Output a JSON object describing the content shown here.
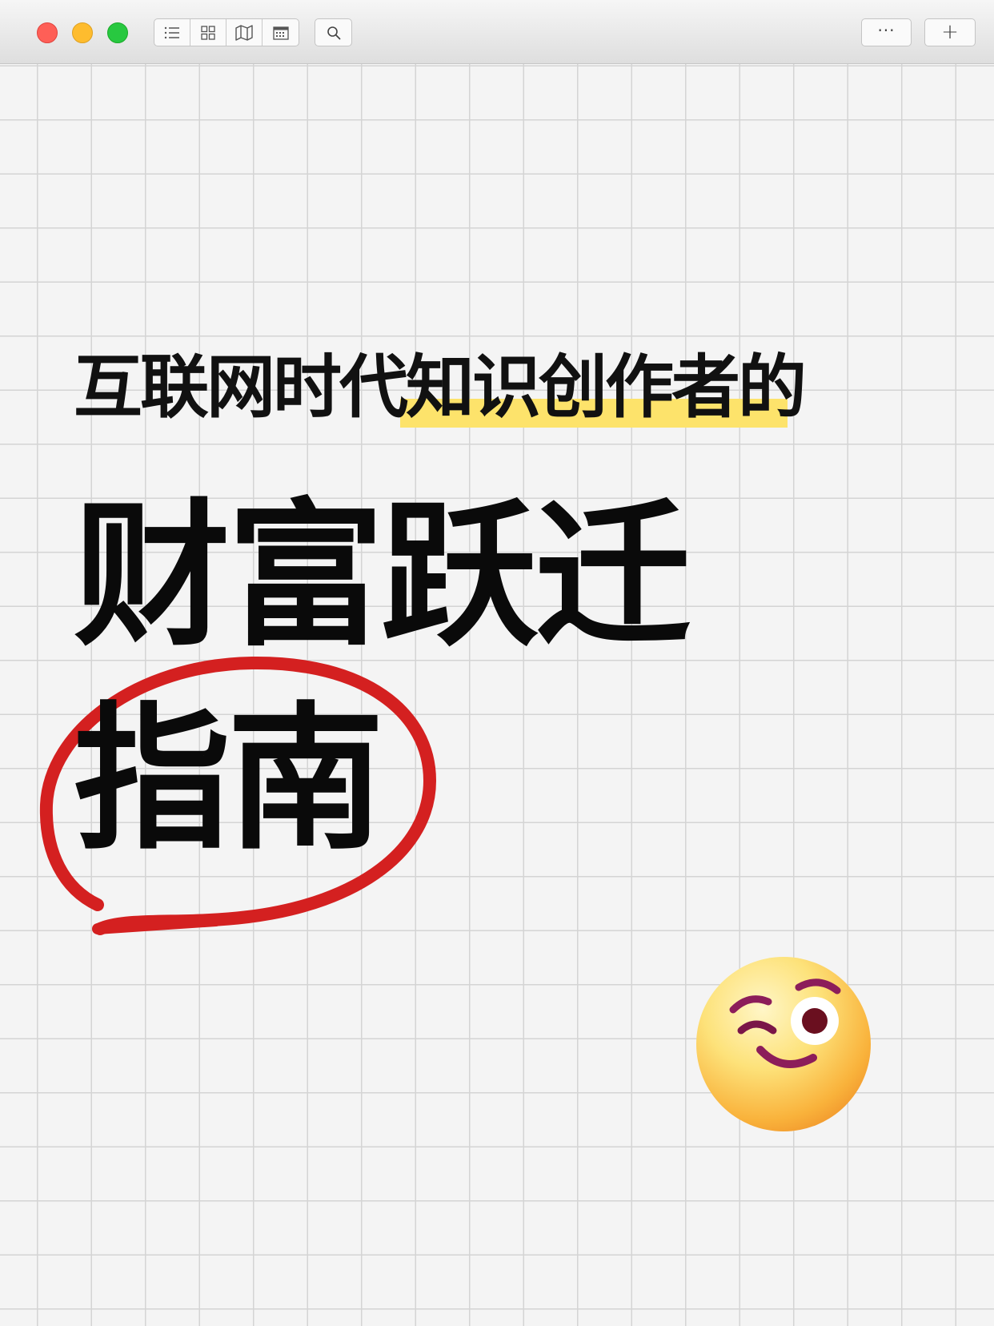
{
  "toolbar": {
    "view_buttons": [
      "list-view",
      "grid-view",
      "map-view",
      "calendar-view"
    ],
    "search_icon": "search-icon",
    "more_label": "···",
    "add_label": "+"
  },
  "colors": {
    "highlight": "#fde36b",
    "circle": "#d42020",
    "text": "#0a0a0a"
  },
  "content": {
    "line1": "互联网时代知识创作者的",
    "line2": "财富跃迁",
    "line3": "指南",
    "emoji_name": "winking-face-emoji"
  }
}
